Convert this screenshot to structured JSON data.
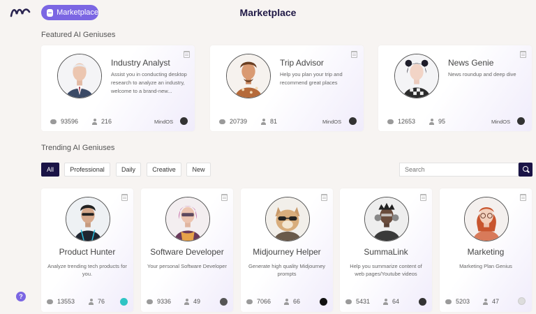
{
  "header": {
    "marketplace_pill": "Marketplace",
    "title": "Marketplace"
  },
  "featured": {
    "heading": "Featured AI Geniuses",
    "cards": [
      {
        "name": "Industry Analyst",
        "description": "Assist you in conducting desktop research to analyze an industry, welcome to a brand-new...",
        "chats": "93596",
        "users": "216",
        "owner": "MindOS"
      },
      {
        "name": "Trip Advisor",
        "description": "Help you plan your trip and recommend great places",
        "chats": "20739",
        "users": "81",
        "owner": "MindOS"
      },
      {
        "name": "News Genie",
        "description": "News roundup and deep dive",
        "chats": "12653",
        "users": "95",
        "owner": "MindOS"
      }
    ]
  },
  "trending": {
    "heading": "Trending AI Geniuses",
    "filters": [
      "All",
      "Professional",
      "Daily",
      "Creative",
      "New"
    ],
    "search_placeholder": "Search",
    "cards": [
      {
        "name": "Product Hunter",
        "description": "Analyze trending tech products for you.",
        "chats": "13553",
        "users": "76"
      },
      {
        "name": "Software Developer",
        "description": "Your personal Software Developer",
        "chats": "9336",
        "users": "49"
      },
      {
        "name": "Midjourney Helper",
        "description": "Generate high quality Midjourney prompts",
        "chats": "7066",
        "users": "66"
      },
      {
        "name": "SummaLink",
        "description": "Help you summarize content of web pages/Youtube videos",
        "chats": "5431",
        "users": "64"
      },
      {
        "name": "Marketing",
        "description": "Marketing Plan Genius",
        "chats": "5203",
        "users": "47"
      }
    ]
  },
  "help_button": "?",
  "colors": {
    "accent": "#7b66e3",
    "dark": "#1a1446",
    "background": "#f7f4f2"
  }
}
